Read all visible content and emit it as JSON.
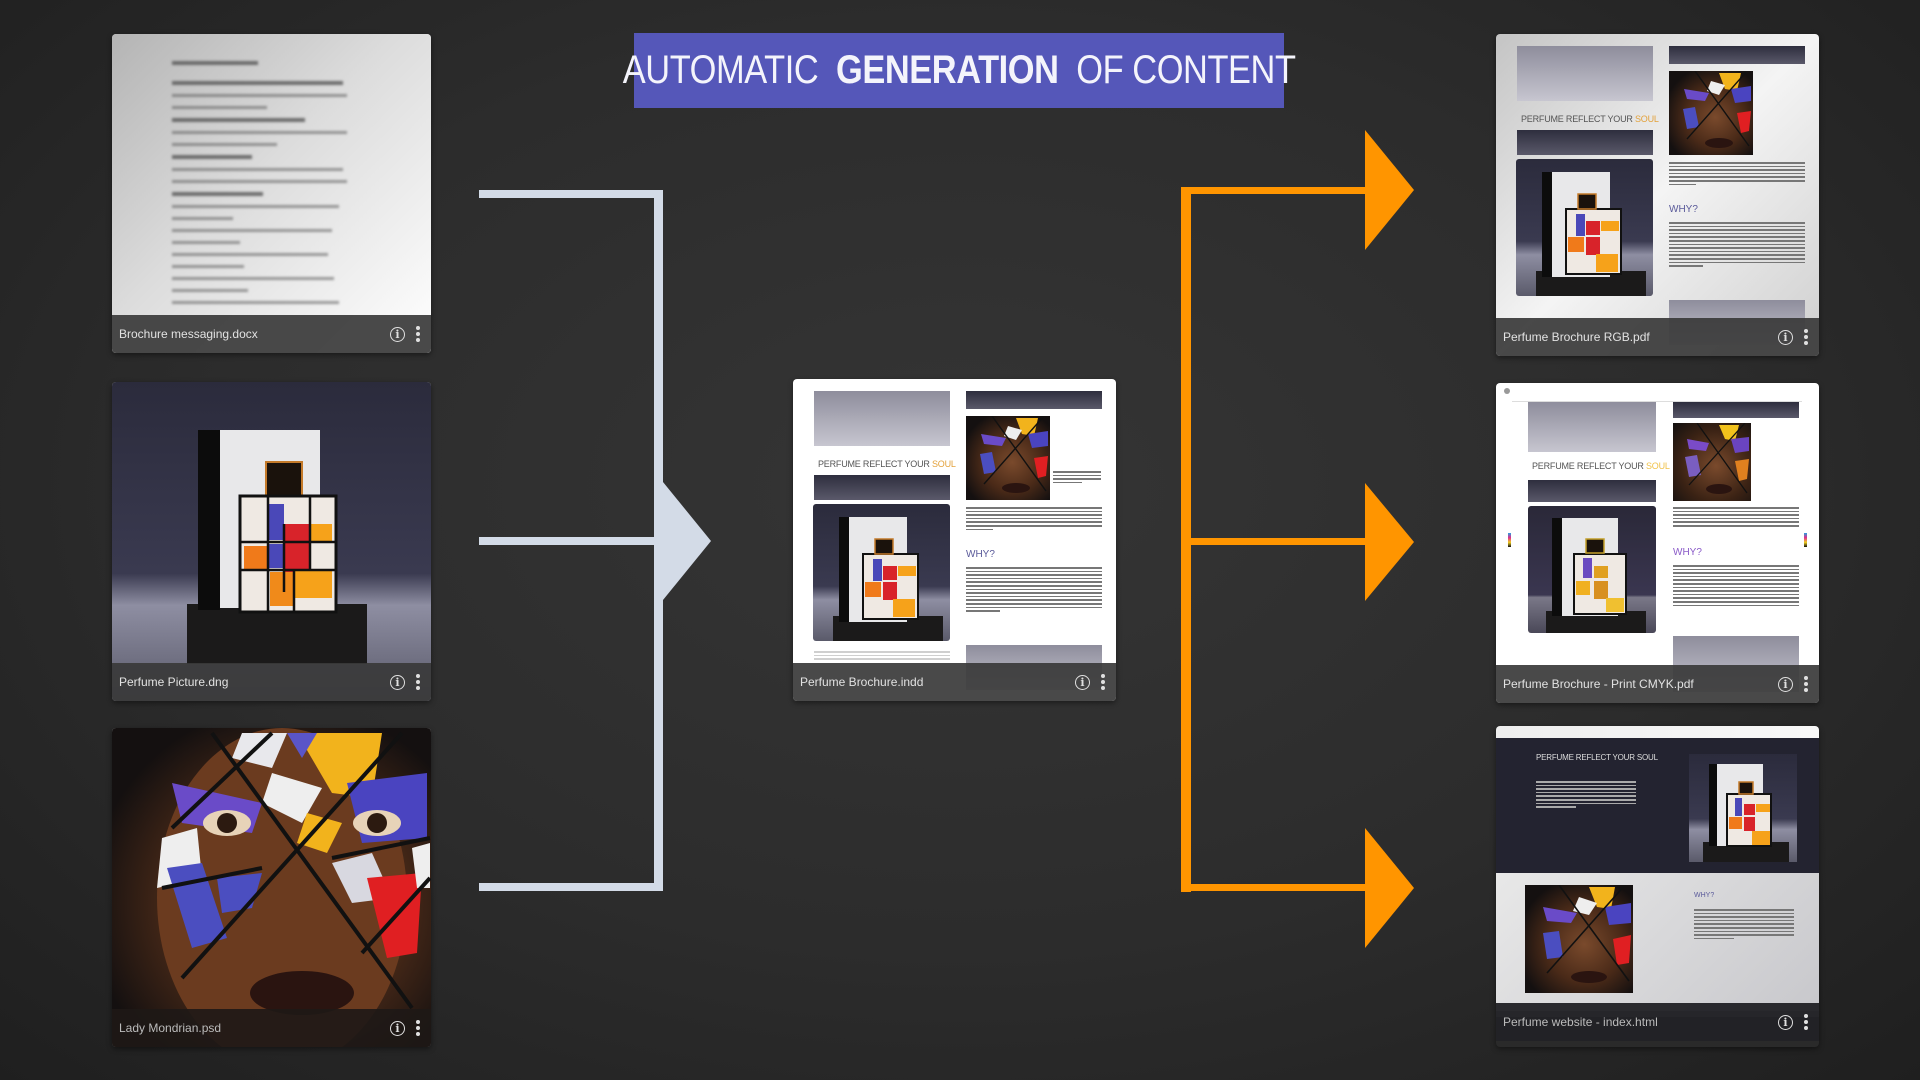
{
  "banner": {
    "prefix": "AUTOMATIC",
    "bold": "GENERATION",
    "suffix": "OF CONTENT",
    "background": "#5557b9"
  },
  "connector_colors": {
    "inputs": "#d3dbe7",
    "outputs": "#ff9500"
  },
  "inputs": [
    {
      "filename": "Brochure messaging.docx",
      "thumbnail": "blurred-document"
    },
    {
      "filename": "Perfume Picture.dng",
      "thumbnail": "perfume-bottle-photo"
    },
    {
      "filename": "Lady Mondrian.psd",
      "thumbnail": "mondrian-face-portrait"
    }
  ],
  "center": {
    "filename": "Perfume Brochure.indd",
    "headline": "PERFUME REFLECT YOUR",
    "headline_accent": "SOUL",
    "subheading": "WHY?"
  },
  "outputs": [
    {
      "filename": "Perfume Brochure RGB.pdf",
      "headline": "PERFUME REFLECT YOUR",
      "headline_accent": "SOUL",
      "subheading": "WHY?"
    },
    {
      "filename": "Perfume Brochure  - Print CMYK.pdf",
      "headline": "PERFUME REFLECT YOUR",
      "headline_accent": "SOUL",
      "subheading": "WHY?"
    },
    {
      "filename": "Perfume website - index.html",
      "headline": "PERFUME REFLECT YOUR SOUL",
      "subheading": "WHY?"
    }
  ],
  "icons": {
    "info": "i",
    "more": "more-vertical"
  }
}
